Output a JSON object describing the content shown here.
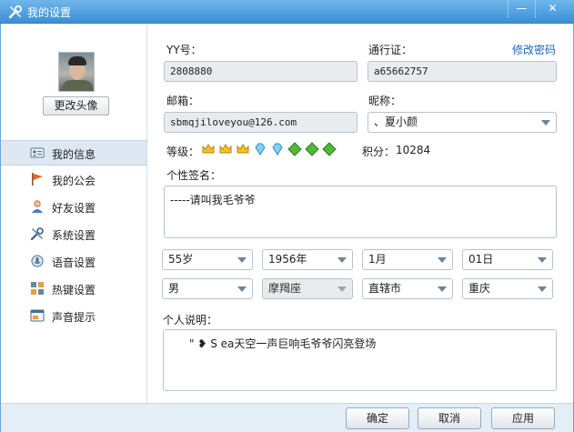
{
  "window": {
    "title": "我的设置",
    "minimize_glyph": "—",
    "close_glyph": "✕"
  },
  "sidebar": {
    "change_avatar_label": "更改头像",
    "items": [
      {
        "label": "我的信息",
        "icon": "profile-card-icon",
        "active": true
      },
      {
        "label": "我的公会",
        "icon": "flag-icon",
        "active": false
      },
      {
        "label": "好友设置",
        "icon": "friend-icon",
        "active": false
      },
      {
        "label": "系统设置",
        "icon": "tools-icon",
        "active": false
      },
      {
        "label": "语音设置",
        "icon": "voice-icon",
        "active": false
      },
      {
        "label": "热键设置",
        "icon": "hotkey-icon",
        "active": false
      },
      {
        "label": "声音提示",
        "icon": "sound-alert-icon",
        "active": false
      }
    ]
  },
  "profile": {
    "yy_label": "YY号：",
    "yy_value": "2808880",
    "passport_label": "通行证：",
    "passport_value": "a65662757",
    "change_password_link": "修改密码",
    "email_label": "邮箱：",
    "email_value": "sbmqjiloveyou@126.com",
    "nickname_label": "昵称：",
    "nickname_value": "、夏小颜",
    "level_label": "等级：",
    "level_badges": [
      "crown-icon",
      "crown-icon",
      "crown-icon",
      "diamond-icon",
      "diamond-icon",
      "leaf-icon",
      "leaf-icon",
      "leaf-icon"
    ],
    "points_label": "积分：",
    "points_value": "10284",
    "signature_label": "个性签名：",
    "signature_value": "-----请叫我毛爷爷",
    "age": "55岁",
    "birth_year": "1956年",
    "birth_month": "1月",
    "birth_day": "01日",
    "gender": "男",
    "zodiac": "摩羯座",
    "city_type": "直辖市",
    "city": "重庆",
    "description_label": "个人说明：",
    "description_value": "\" ❥ S ea天空一声巨响毛爷爷闪亮登场"
  },
  "footer": {
    "ok_label": "确定",
    "cancel_label": "取消",
    "apply_label": "应用"
  },
  "colors": {
    "titlebar": "#3b8fd6",
    "link": "#1a67b8",
    "nav_active": "#dde8f3",
    "footer": "#e4eef7"
  }
}
